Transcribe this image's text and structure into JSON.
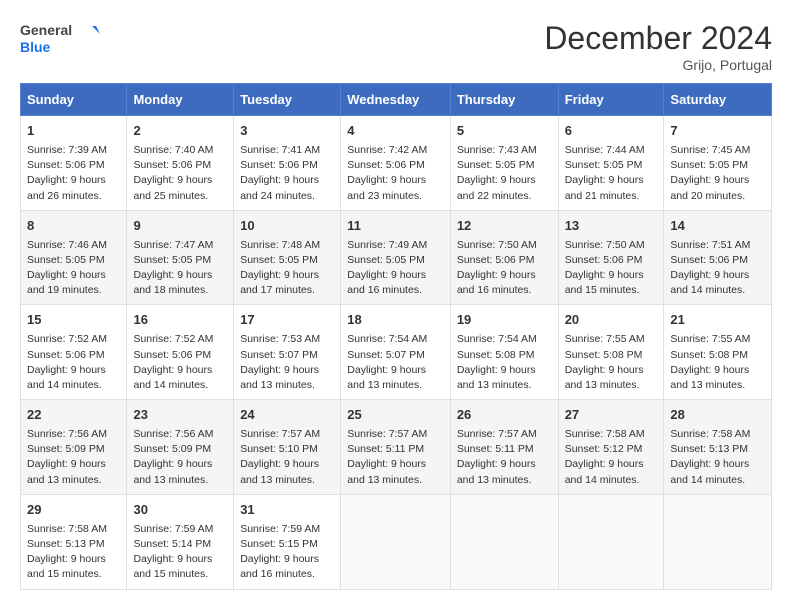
{
  "logo": {
    "line1": "General",
    "line2": "Blue"
  },
  "title": "December 2024",
  "subtitle": "Grijo, Portugal",
  "headers": [
    "Sunday",
    "Monday",
    "Tuesday",
    "Wednesday",
    "Thursday",
    "Friday",
    "Saturday"
  ],
  "weeks": [
    [
      {
        "day": "1",
        "sunrise": "Sunrise: 7:39 AM",
        "sunset": "Sunset: 5:06 PM",
        "daylight": "Daylight: 9 hours and 26 minutes."
      },
      {
        "day": "2",
        "sunrise": "Sunrise: 7:40 AM",
        "sunset": "Sunset: 5:06 PM",
        "daylight": "Daylight: 9 hours and 25 minutes."
      },
      {
        "day": "3",
        "sunrise": "Sunrise: 7:41 AM",
        "sunset": "Sunset: 5:06 PM",
        "daylight": "Daylight: 9 hours and 24 minutes."
      },
      {
        "day": "4",
        "sunrise": "Sunrise: 7:42 AM",
        "sunset": "Sunset: 5:06 PM",
        "daylight": "Daylight: 9 hours and 23 minutes."
      },
      {
        "day": "5",
        "sunrise": "Sunrise: 7:43 AM",
        "sunset": "Sunset: 5:05 PM",
        "daylight": "Daylight: 9 hours and 22 minutes."
      },
      {
        "day": "6",
        "sunrise": "Sunrise: 7:44 AM",
        "sunset": "Sunset: 5:05 PM",
        "daylight": "Daylight: 9 hours and 21 minutes."
      },
      {
        "day": "7",
        "sunrise": "Sunrise: 7:45 AM",
        "sunset": "Sunset: 5:05 PM",
        "daylight": "Daylight: 9 hours and 20 minutes."
      }
    ],
    [
      {
        "day": "8",
        "sunrise": "Sunrise: 7:46 AM",
        "sunset": "Sunset: 5:05 PM",
        "daylight": "Daylight: 9 hours and 19 minutes."
      },
      {
        "day": "9",
        "sunrise": "Sunrise: 7:47 AM",
        "sunset": "Sunset: 5:05 PM",
        "daylight": "Daylight: 9 hours and 18 minutes."
      },
      {
        "day": "10",
        "sunrise": "Sunrise: 7:48 AM",
        "sunset": "Sunset: 5:05 PM",
        "daylight": "Daylight: 9 hours and 17 minutes."
      },
      {
        "day": "11",
        "sunrise": "Sunrise: 7:49 AM",
        "sunset": "Sunset: 5:05 PM",
        "daylight": "Daylight: 9 hours and 16 minutes."
      },
      {
        "day": "12",
        "sunrise": "Sunrise: 7:50 AM",
        "sunset": "Sunset: 5:06 PM",
        "daylight": "Daylight: 9 hours and 16 minutes."
      },
      {
        "day": "13",
        "sunrise": "Sunrise: 7:50 AM",
        "sunset": "Sunset: 5:06 PM",
        "daylight": "Daylight: 9 hours and 15 minutes."
      },
      {
        "day": "14",
        "sunrise": "Sunrise: 7:51 AM",
        "sunset": "Sunset: 5:06 PM",
        "daylight": "Daylight: 9 hours and 14 minutes."
      }
    ],
    [
      {
        "day": "15",
        "sunrise": "Sunrise: 7:52 AM",
        "sunset": "Sunset: 5:06 PM",
        "daylight": "Daylight: 9 hours and 14 minutes."
      },
      {
        "day": "16",
        "sunrise": "Sunrise: 7:52 AM",
        "sunset": "Sunset: 5:06 PM",
        "daylight": "Daylight: 9 hours and 14 minutes."
      },
      {
        "day": "17",
        "sunrise": "Sunrise: 7:53 AM",
        "sunset": "Sunset: 5:07 PM",
        "daylight": "Daylight: 9 hours and 13 minutes."
      },
      {
        "day": "18",
        "sunrise": "Sunrise: 7:54 AM",
        "sunset": "Sunset: 5:07 PM",
        "daylight": "Daylight: 9 hours and 13 minutes."
      },
      {
        "day": "19",
        "sunrise": "Sunrise: 7:54 AM",
        "sunset": "Sunset: 5:08 PM",
        "daylight": "Daylight: 9 hours and 13 minutes."
      },
      {
        "day": "20",
        "sunrise": "Sunrise: 7:55 AM",
        "sunset": "Sunset: 5:08 PM",
        "daylight": "Daylight: 9 hours and 13 minutes."
      },
      {
        "day": "21",
        "sunrise": "Sunrise: 7:55 AM",
        "sunset": "Sunset: 5:08 PM",
        "daylight": "Daylight: 9 hours and 13 minutes."
      }
    ],
    [
      {
        "day": "22",
        "sunrise": "Sunrise: 7:56 AM",
        "sunset": "Sunset: 5:09 PM",
        "daylight": "Daylight: 9 hours and 13 minutes."
      },
      {
        "day": "23",
        "sunrise": "Sunrise: 7:56 AM",
        "sunset": "Sunset: 5:09 PM",
        "daylight": "Daylight: 9 hours and 13 minutes."
      },
      {
        "day": "24",
        "sunrise": "Sunrise: 7:57 AM",
        "sunset": "Sunset: 5:10 PM",
        "daylight": "Daylight: 9 hours and 13 minutes."
      },
      {
        "day": "25",
        "sunrise": "Sunrise: 7:57 AM",
        "sunset": "Sunset: 5:11 PM",
        "daylight": "Daylight: 9 hours and 13 minutes."
      },
      {
        "day": "26",
        "sunrise": "Sunrise: 7:57 AM",
        "sunset": "Sunset: 5:11 PM",
        "daylight": "Daylight: 9 hours and 13 minutes."
      },
      {
        "day": "27",
        "sunrise": "Sunrise: 7:58 AM",
        "sunset": "Sunset: 5:12 PM",
        "daylight": "Daylight: 9 hours and 14 minutes."
      },
      {
        "day": "28",
        "sunrise": "Sunrise: 7:58 AM",
        "sunset": "Sunset: 5:13 PM",
        "daylight": "Daylight: 9 hours and 14 minutes."
      }
    ],
    [
      {
        "day": "29",
        "sunrise": "Sunrise: 7:58 AM",
        "sunset": "Sunset: 5:13 PM",
        "daylight": "Daylight: 9 hours and 15 minutes."
      },
      {
        "day": "30",
        "sunrise": "Sunrise: 7:59 AM",
        "sunset": "Sunset: 5:14 PM",
        "daylight": "Daylight: 9 hours and 15 minutes."
      },
      {
        "day": "31",
        "sunrise": "Sunrise: 7:59 AM",
        "sunset": "Sunset: 5:15 PM",
        "daylight": "Daylight: 9 hours and 16 minutes."
      },
      null,
      null,
      null,
      null
    ]
  ]
}
